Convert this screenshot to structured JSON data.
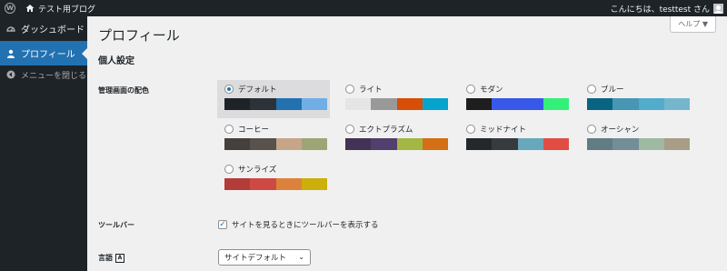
{
  "adminbar": {
    "site_name": "テスト用ブログ",
    "greeting": "こんにちは、testtest さん"
  },
  "sidebar": {
    "items": [
      {
        "label": "ダッシュボード",
        "icon": "dashboard-icon"
      },
      {
        "label": "プロフィール",
        "icon": "user-icon",
        "current": true
      },
      {
        "label": "メニューを閉じる",
        "icon": "collapse-icon"
      }
    ]
  },
  "main": {
    "title": "プロフィール",
    "help_label": "ヘルプ ▼",
    "section_title": "個人設定",
    "color_scheme_label": "管理画面の配色",
    "color_schemes": [
      {
        "name": "デフォルト",
        "selected": true,
        "colors": [
          "#1d2327",
          "#2c3338",
          "#2271b1",
          "#72aee6"
        ]
      },
      {
        "name": "ライト",
        "selected": false,
        "colors": [
          "#e5e5e5",
          "#999999",
          "#d64e07",
          "#04a4cc"
        ]
      },
      {
        "name": "モダン",
        "selected": false,
        "colors": [
          "#1e1e1e",
          "#3858e9",
          "#3858e9",
          "#33f078"
        ]
      },
      {
        "name": "ブルー",
        "selected": false,
        "colors": [
          "#096484",
          "#4796b3",
          "#52accc",
          "#74b6ce"
        ]
      },
      {
        "name": "コーヒー",
        "selected": false,
        "colors": [
          "#46403c",
          "#59524c",
          "#c7a589",
          "#9ea476"
        ]
      },
      {
        "name": "エクトプラズム",
        "selected": false,
        "colors": [
          "#413256",
          "#523f6d",
          "#a3b745",
          "#d46f15"
        ]
      },
      {
        "name": "ミッドナイト",
        "selected": false,
        "colors": [
          "#25282b",
          "#363b3f",
          "#69a8bb",
          "#e14d43"
        ]
      },
      {
        "name": "オーシャン",
        "selected": false,
        "colors": [
          "#627c83",
          "#738e96",
          "#9ebaa0",
          "#aa9d88"
        ]
      },
      {
        "name": "サンライズ",
        "selected": false,
        "colors": [
          "#b43c38",
          "#cf4944",
          "#dd823b",
          "#ccaf0b"
        ]
      }
    ],
    "toolbar_label": "ツールバー",
    "toolbar_option": "サイトを見るときにツールバーを表示する",
    "toolbar_checked": true,
    "language_label": "言語",
    "language_value": "サイトデフォルト"
  }
}
